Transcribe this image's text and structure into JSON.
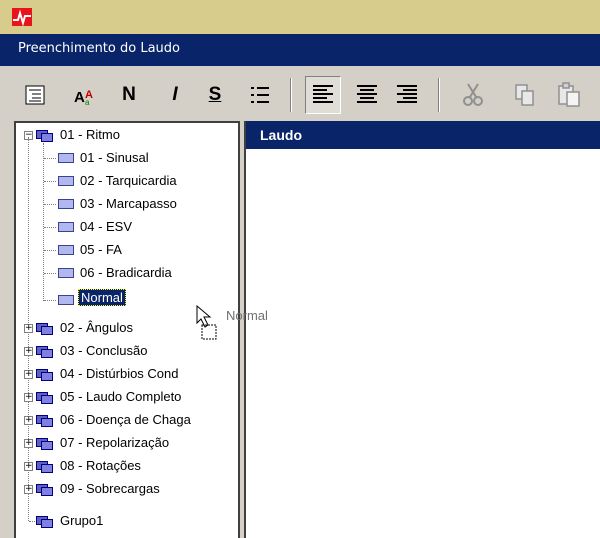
{
  "window": {
    "title": "Preenchimento do Laudo"
  },
  "toolbar": {
    "bold_label": "N",
    "italic_label": "I",
    "strike_label": "S"
  },
  "tree": {
    "root": {
      "label": "01 - Ritmo"
    },
    "children": [
      {
        "label": "01 - Sinusal"
      },
      {
        "label": "02 - Tarquicardia"
      },
      {
        "label": "03 - Marcapasso"
      },
      {
        "label": "04 - ESV"
      },
      {
        "label": "05 - FA"
      },
      {
        "label": "06 - Bradicardia"
      },
      {
        "label": "Normal"
      }
    ],
    "groups": [
      {
        "label": "02 - Ângulos"
      },
      {
        "label": "03 - Conclusão"
      },
      {
        "label": "04 - Distúrbios Cond"
      },
      {
        "label": "05 - Laudo Completo"
      },
      {
        "label": "06 - Doença de Chaga"
      },
      {
        "label": "07 - Repolarização"
      },
      {
        "label": "08 - Rotações"
      },
      {
        "label": "09 - Sobrecargas"
      },
      {
        "label": "Grupo1"
      }
    ]
  },
  "drag": {
    "label": "Normal"
  },
  "laudo": {
    "header": "Laudo"
  },
  "colors": {
    "titlebar": "#0a246a",
    "appbar": "#d8cc8c",
    "selection": "#0a246a"
  },
  "icons": [
    "app-icon",
    "outline-icon",
    "font-icon",
    "bullet-list-icon",
    "align-left-icon",
    "align-center-icon",
    "align-right-icon",
    "cut-icon",
    "copy-icon",
    "paste-icon"
  ]
}
